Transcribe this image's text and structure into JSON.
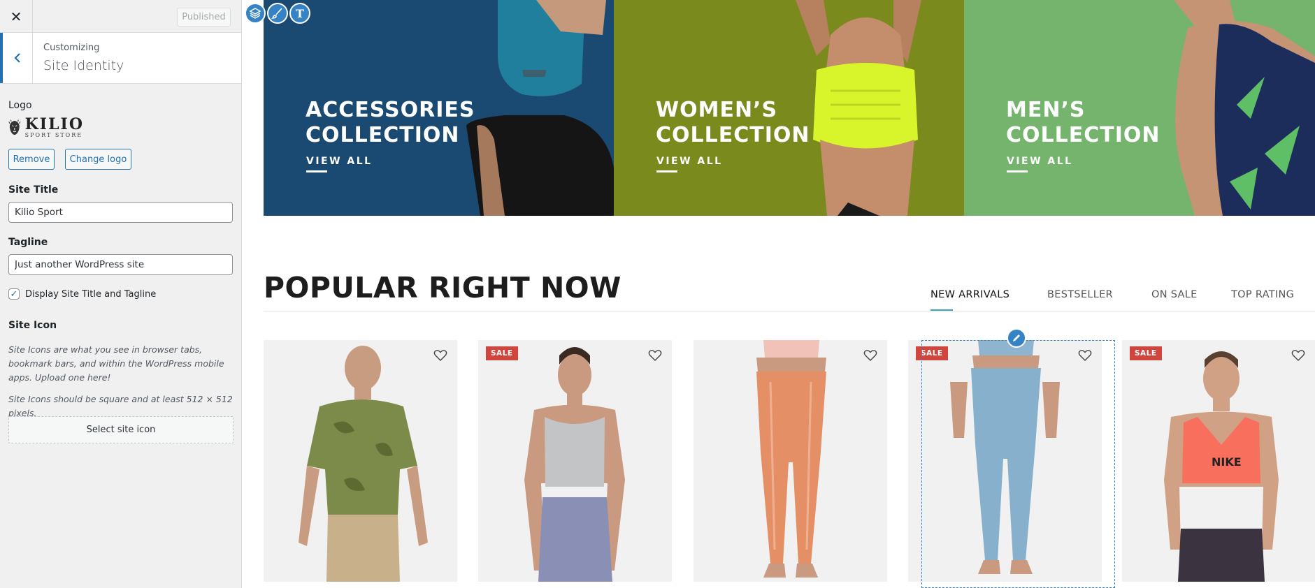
{
  "customizer": {
    "close_icon": "close-icon",
    "publish_label": "Published",
    "section_crumb": "Customizing",
    "section_title": "Site Identity",
    "logo": {
      "label": "Logo",
      "brand": "KILIO",
      "brand_sub": "SPORT STORE",
      "remove_label": "Remove",
      "change_label": "Change logo"
    },
    "site_title": {
      "label": "Site Title",
      "value": "Kilio Sport"
    },
    "tagline": {
      "label": "Tagline",
      "value": "Just another WordPress site"
    },
    "display_title_tagline": {
      "label": "Display Site Title and Tagline",
      "checked": true
    },
    "site_icon": {
      "label": "Site Icon",
      "desc1": "Site Icons are what you see in browser tabs, bookmark bars, and within the WordPress mobile apps. Upload one here!",
      "desc2": "Site Icons should be square and at least 512 × 512 pixels.",
      "select_label": "Select site icon"
    }
  },
  "preview": {
    "banners": [
      {
        "title_line1": "ACCESSORIES",
        "title_line2": "COLLECTION",
        "link": "VIEW ALL",
        "bg": "#1a4a72"
      },
      {
        "title_line1": "WOMEN’S",
        "title_line2": "COLLECTION",
        "link": "VIEW ALL",
        "bg": "#7a8a1c"
      },
      {
        "title_line1": "MEN’S",
        "title_line2": "COLLECTION",
        "link": "VIEW ALL",
        "bg": "#74b46c"
      }
    ],
    "section_title": "POPULAR RIGHT NOW",
    "tabs": [
      "NEW ARRIVALS",
      "BESTSELLER",
      "ON SALE",
      "TOP RATING"
    ],
    "active_tab": "NEW ARRIVALS",
    "sale_label": "SALE",
    "products": [
      {
        "item": "tie-dye t-shirt",
        "sale": false
      },
      {
        "item": "crop tank and leggings",
        "sale": true
      },
      {
        "item": "orange leggings",
        "sale": false
      },
      {
        "item": "blue leggings",
        "sale": true
      },
      {
        "item": "sports bra",
        "sale": true
      }
    ],
    "accent_color": "#3582c4"
  }
}
